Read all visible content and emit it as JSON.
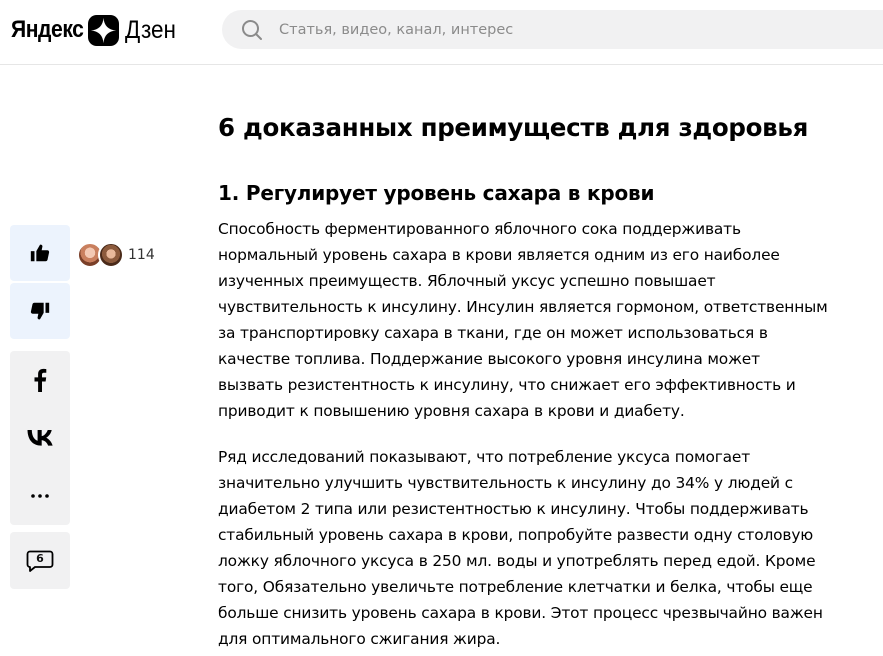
{
  "header": {
    "logo_yandex": "Яндекс",
    "logo_dzen": "Дзен",
    "search_placeholder": "Статья, видео, канал, интерес"
  },
  "sidebar": {
    "like_count": "114",
    "comment_count": "6",
    "icons": [
      "thumb-up-icon",
      "thumb-down-icon",
      "facebook-icon",
      "vk-icon",
      "more-dots-icon",
      "comment-icon"
    ]
  },
  "article": {
    "heading": "6 доказанных преимуществ для здоровья",
    "subheading": "1. Регулирует уровень сахара в крови",
    "paragraph1": "Способность ферментированного яблочного сока поддерживать нормальный уровень сахара в крови является одним из его наиболее изученных преимуществ. Яблочный уксус успешно повышает чувствительность к инсулину. Инсулин является гормоном, ответственным за транспортировку сахара в ткани, где он может использоваться в качестве топлива. Поддержание высокого уровня инсулина может вызвать резистентность к инсулину, что снижает его эффективность и приводит к повышению уровня сахара в крови и диабету.",
    "paragraph2": "Ряд исследований показывают, что потребление уксуса помогает значительно улучшить чувствительность к инсулину до 34% у людей с диабетом 2 типа или резистентностью к инсулину. Чтобы поддерживать стабильный уровень сахара в крови, попробуйте развести одну столовую ложку яблочного уксуса в 250 мл. воды и употреблять перед едой. Кроме того, Обязательно увеличьте потребление клетчатки и белка, чтобы еще больше снизить уровень сахара в крови. Этот процесс чрезвычайно важен для оптимального сжигания жира."
  },
  "colors": {
    "like_bg": "#ecf3fd",
    "panel_bg": "#f1f1f2",
    "search_bg": "#f1f1f2"
  }
}
